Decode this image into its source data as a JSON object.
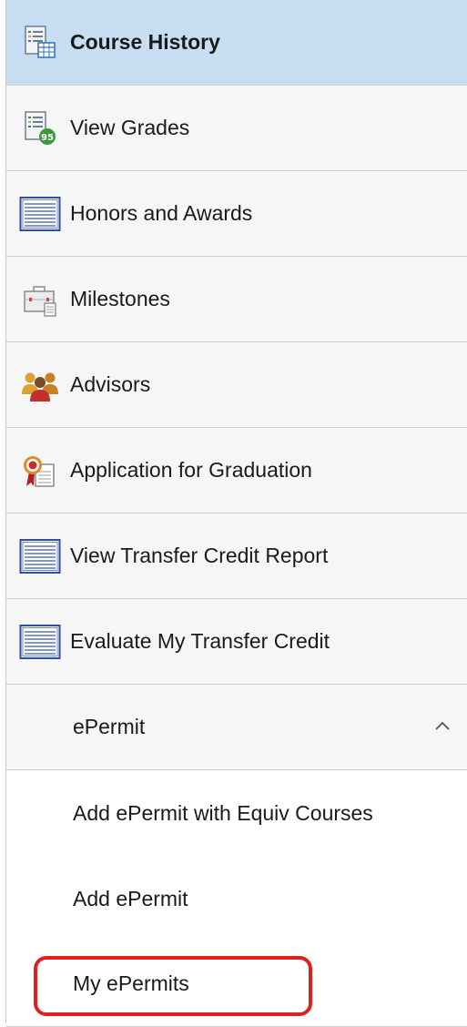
{
  "nav": {
    "items": [
      {
        "label": "Course History",
        "icon": "course-history-icon",
        "active": true
      },
      {
        "label": "View Grades",
        "icon": "view-grades-icon"
      },
      {
        "label": "Honors and Awards",
        "icon": "list-document-icon"
      },
      {
        "label": "Milestones",
        "icon": "briefcase-icon"
      },
      {
        "label": "Advisors",
        "icon": "people-icon"
      },
      {
        "label": "Application for Graduation",
        "icon": "award-ribbon-icon"
      },
      {
        "label": "View Transfer Credit Report",
        "icon": "list-document-icon"
      },
      {
        "label": "Evaluate My Transfer Credit",
        "icon": "list-document-icon"
      }
    ],
    "group": {
      "label": "ePermit",
      "icon": "chevron-up-icon",
      "sub_items": [
        {
          "label": "Add ePermit with Equiv Courses"
        },
        {
          "label": "Add ePermit"
        },
        {
          "label": "My ePermits",
          "highlighted": true
        }
      ]
    }
  },
  "colors": {
    "active_bg": "#c7def2",
    "highlight_border": "#e0201d",
    "item_bg": "#f6f6f6"
  }
}
